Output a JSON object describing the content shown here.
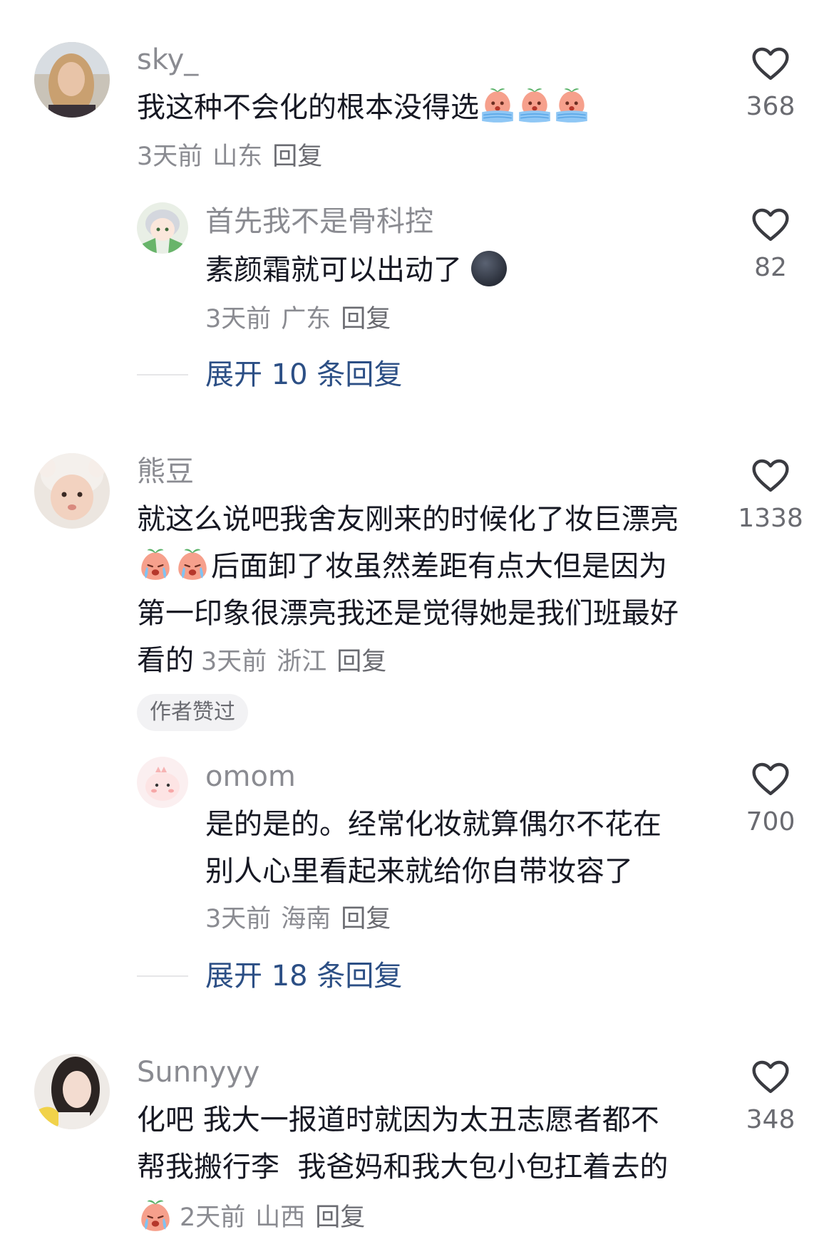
{
  "comments": [
    {
      "username": "sky_",
      "text": "我这种不会化的根本没得选",
      "time": "3天前",
      "location": "山东",
      "reply": "回复",
      "likes": "368",
      "replies": [
        {
          "username": "首先我不是骨科控",
          "text": "素颜霜就可以出动了",
          "time": "3天前",
          "location": "广东",
          "reply": "回复",
          "likes": "82"
        }
      ],
      "expand": "展开 10 条回复"
    },
    {
      "username": "熊豆",
      "text_line1": "就这么说吧我舍友刚来的时候化了妆巨漂亮",
      "text_line2": "后面卸了妆虽然差距有点大但是因为",
      "text_line3": "第一印象很漂亮我还是觉得她是我们班最好",
      "text_line4": "看的",
      "time": "3天前",
      "location": "浙江",
      "reply": "回复",
      "likes": "1338",
      "badge": "作者赞过",
      "replies": [
        {
          "username": "omom",
          "text_line1": "是的是的。经常化妆就算偶尔不花在",
          "text_line2": "别人心里看起来就给你自带妆容了",
          "time": "3天前",
          "location": "海南",
          "reply": "回复",
          "likes": "700"
        }
      ],
      "expand": "展开 18 条回复"
    },
    {
      "username": "Sunnyyy",
      "text_line1": "化吧 我大一报道时就因为太丑志愿者都不",
      "text_line2": "帮我搬行李  我爸妈和我大包小包扛着去的",
      "time": "2天前",
      "location": "山西",
      "reply": "回复",
      "likes": "348"
    }
  ],
  "icons": {
    "like": "heart-outline-icon",
    "cry_emoji": "peach-crying-emoji",
    "moon_emoji": "new-moon-face-emoji"
  },
  "colors": {
    "username": "#8a8b91",
    "text": "#161823",
    "link": "#2c4f85",
    "badge_bg": "#f2f2f4"
  }
}
